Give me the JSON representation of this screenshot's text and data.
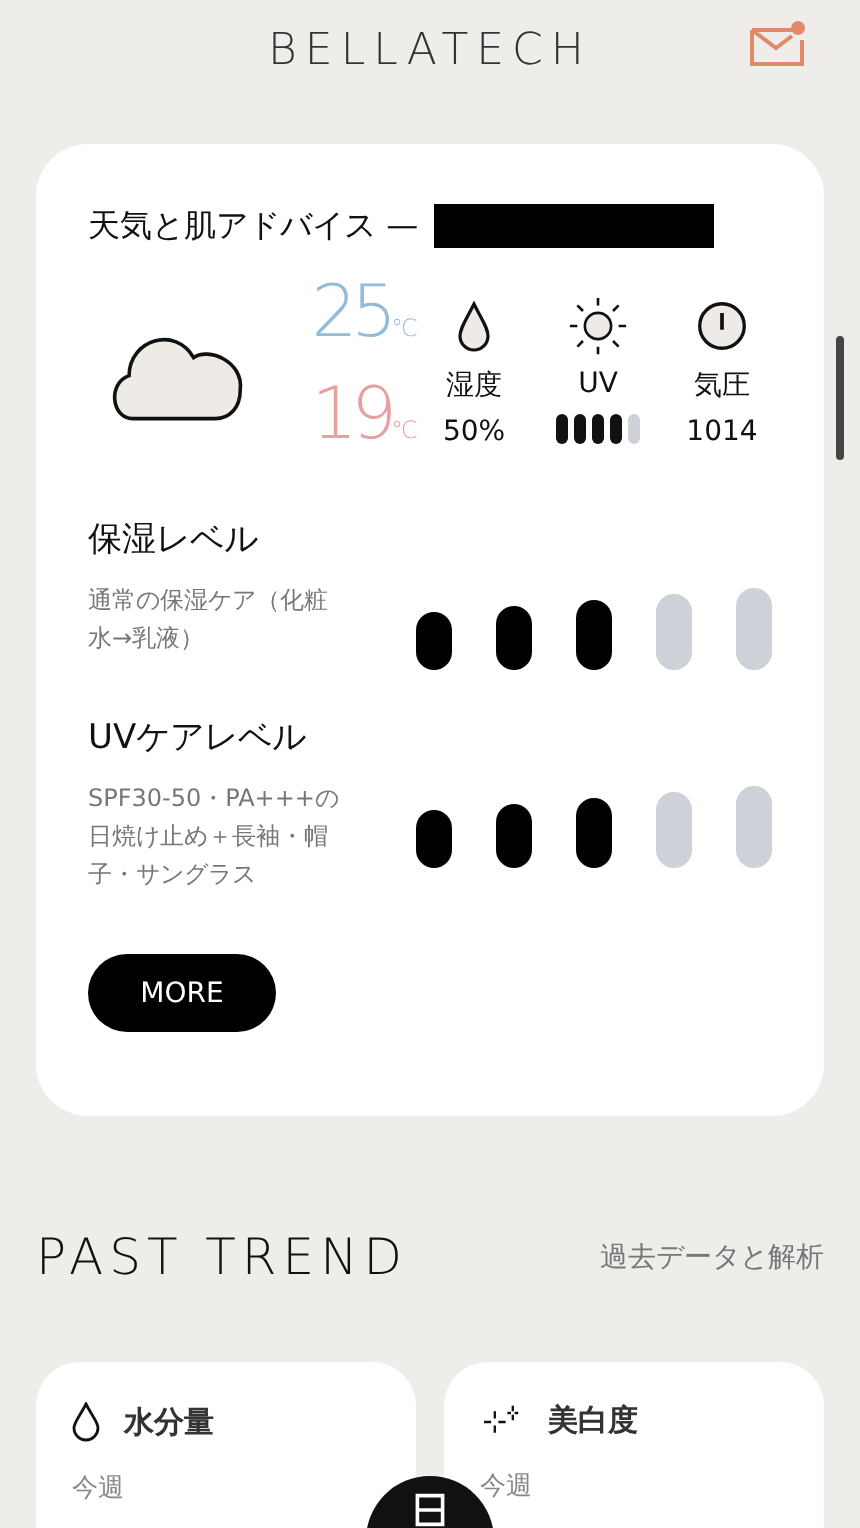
{
  "header": {
    "logo": "BELLATECH",
    "has_unread": true
  },
  "advice_card": {
    "title": "天気と肌アドバイス —",
    "redacted": true,
    "temp_high": {
      "value": "25",
      "unit": "℃"
    },
    "temp_low": {
      "value": "19",
      "unit": "℃"
    },
    "stats": [
      {
        "kind": "text",
        "label": "湿度",
        "reading": "50%"
      },
      {
        "kind": "meter",
        "label": "UV",
        "level": 0.8
      },
      {
        "kind": "text",
        "label": "気圧",
        "reading": "1014"
      }
    ],
    "levels": [
      {
        "title": "保湿レベル",
        "description": "通常の保湿ケア（化粧水→乳液）",
        "level": 0.6
      },
      {
        "title": "UVケアレベル",
        "description": "SPF30-50・PA+++の日焼け止め＋長袖・帽子・サングラス",
        "level": 0.6
      }
    ],
    "button": "MORE"
  },
  "past_trend": {
    "title": "PAST TREND",
    "link": "過去データと解析",
    "cards": [
      {
        "title": "水分量",
        "period": "今週"
      },
      {
        "title": "美白度",
        "period": "今週"
      }
    ]
  }
}
